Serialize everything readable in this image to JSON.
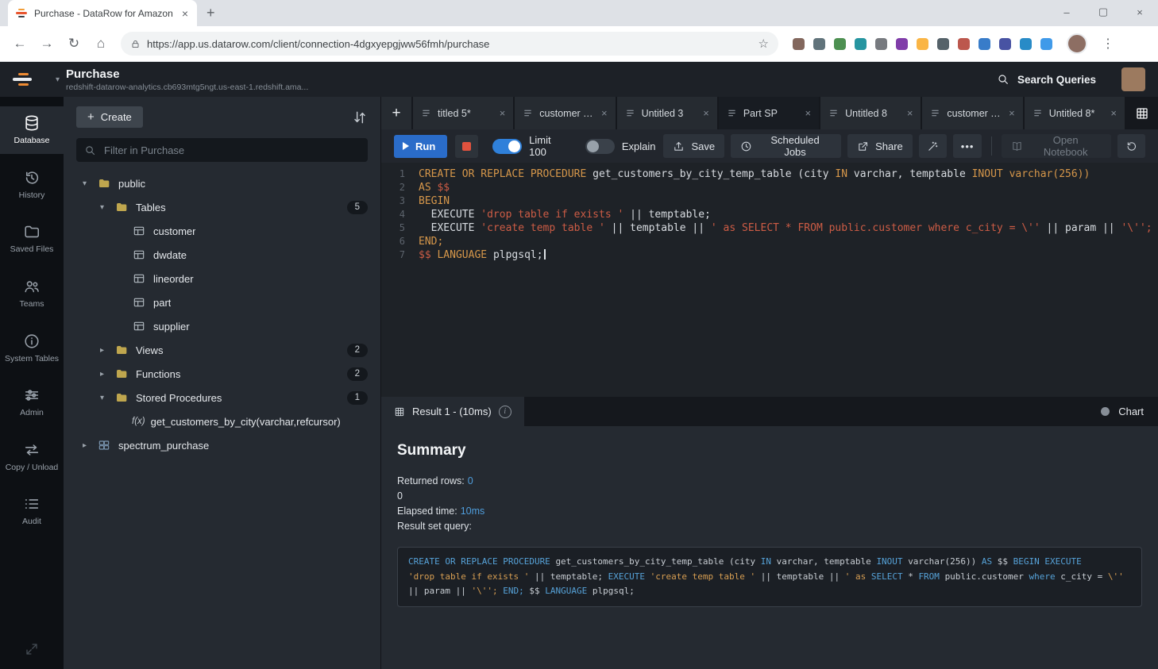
{
  "icons": {
    "plus": "+",
    "close": "×",
    "minimize": "–",
    "maximize": "▢",
    "menu_dots": "⋮",
    "back": "←",
    "forward": "→",
    "reload": "↻",
    "home": "⌂",
    "star": "☆",
    "caret_down": "▾",
    "chevron_down": "▾",
    "chevron_right": "▸",
    "more": "•••"
  },
  "browser": {
    "tab_title": "Purchase - DataRow for Amazon",
    "url": "https://app.us.datarow.com/client/connection-4dgxyepgjww56fmh/purchase",
    "extension_colors": [
      "#6d4c41",
      "#455a64",
      "#2e7d32",
      "#00838f",
      "#5f6368",
      "#6a1b9a",
      "#f9a825",
      "#37474f",
      "#b03a2e",
      "#1565c0",
      "#283593",
      "#0277bd",
      "#1e88e5"
    ]
  },
  "header": {
    "title": "Purchase",
    "subtitle": "redshift-datarow-analytics.cb693mtg5ngt.us-east-1.redshift.ama...",
    "search_label": "Search Queries"
  },
  "sidebar": [
    {
      "label": "Database",
      "icon": "database",
      "active": true
    },
    {
      "label": "History",
      "icon": "history"
    },
    {
      "label": "Saved Files",
      "icon": "folder"
    },
    {
      "label": "Teams",
      "icon": "teams"
    },
    {
      "label": "System Tables",
      "icon": "info"
    },
    {
      "label": "Admin",
      "icon": "sliders"
    },
    {
      "label": "Copy / Unload",
      "icon": "copyunload"
    },
    {
      "label": "Audit",
      "icon": "audit"
    }
  ],
  "explorer": {
    "create_label": "Create",
    "filter_placeholder": "Filter in Purchase",
    "tree": [
      {
        "label": "public",
        "level": 0,
        "chevron": "down",
        "icon": "folder"
      },
      {
        "label": "Tables",
        "level": 1,
        "chevron": "down",
        "icon": "folder",
        "badge": "5"
      },
      {
        "label": "customer",
        "level": 2,
        "icon": "table"
      },
      {
        "label": "dwdate",
        "level": 2,
        "icon": "table"
      },
      {
        "label": "lineorder",
        "level": 2,
        "icon": "table"
      },
      {
        "label": "part",
        "level": 2,
        "icon": "table"
      },
      {
        "label": "supplier",
        "level": 2,
        "icon": "table"
      },
      {
        "label": "Views",
        "level": 1,
        "chevron": "right",
        "icon": "folder",
        "badge": "2"
      },
      {
        "label": "Functions",
        "level": 1,
        "chevron": "right",
        "icon": "folder",
        "badge": "2"
      },
      {
        "label": "Stored Procedures",
        "level": 1,
        "chevron": "down",
        "icon": "folder",
        "badge": "1"
      },
      {
        "label": "get_customers_by_city(varchar,refcursor)",
        "level": 2,
        "icon": "function"
      },
      {
        "label": "spectrum_purchase",
        "level": 0,
        "chevron": "right",
        "icon": "schema"
      }
    ]
  },
  "editor": {
    "tabs": [
      {
        "label": "titled 5*"
      },
      {
        "label": "customer Table"
      },
      {
        "label": "Untitled 3"
      },
      {
        "label": "Part SP",
        "active": true
      },
      {
        "label": "Untitled 8"
      },
      {
        "label": "customer Table*"
      },
      {
        "label": "Untitled 8*"
      }
    ],
    "toolbar": {
      "run": "Run",
      "limit": "Limit 100",
      "explain": "Explain",
      "save": "Save",
      "scheduled_jobs": "Scheduled Jobs",
      "share": "Share",
      "open_notebook": "Open Notebook"
    },
    "code": [
      [
        {
          "t": "CREATE OR REPLACE PROCEDURE ",
          "c": "kw"
        },
        {
          "t": "get_customers_by_city_temp_table (city ",
          "c": "pl"
        },
        {
          "t": "IN ",
          "c": "kw"
        },
        {
          "t": "varchar, temptable ",
          "c": "pl"
        },
        {
          "t": "INOUT ",
          "c": "kw"
        },
        {
          "t": "varchar(256))",
          "c": "kw"
        }
      ],
      [
        {
          "t": "AS ",
          "c": "kw"
        },
        {
          "t": "$$",
          "c": "str"
        }
      ],
      [
        {
          "t": "BEGIN",
          "c": "kw"
        }
      ],
      [
        {
          "t": "  EXECUTE ",
          "c": "pl"
        },
        {
          "t": "'drop table if exists '",
          "c": "str"
        },
        {
          "t": " || temptable;",
          "c": "pl"
        }
      ],
      [
        {
          "t": "  EXECUTE ",
          "c": "pl"
        },
        {
          "t": "'create temp table '",
          "c": "str"
        },
        {
          "t": " || temptable || ",
          "c": "pl"
        },
        {
          "t": "' as SELECT * FROM public.customer where c_city = \\''",
          "c": "str"
        },
        {
          "t": " || param || ",
          "c": "pl"
        },
        {
          "t": "'\\'';",
          "c": "str"
        }
      ],
      [
        {
          "t": "END;",
          "c": "kw"
        }
      ],
      [
        {
          "t": "$$ ",
          "c": "str"
        },
        {
          "t": "LANGUAGE ",
          "c": "kw"
        },
        {
          "t": "plpgsql;",
          "c": "pl"
        }
      ]
    ]
  },
  "results": {
    "tab_label": "Result 1 - (10ms)",
    "chart_label": "Chart",
    "summary_title": "Summary",
    "returned_rows_label": "Returned rows:",
    "returned_rows_value": "0",
    "secondary_value": "0",
    "elapsed_label": "Elapsed time:",
    "elapsed_value": "10ms",
    "query_label": "Result set query:",
    "query": [
      [
        {
          "t": "CREATE OR REPLACE PROCEDURE ",
          "c": "kw"
        },
        {
          "t": "get_customers_by_city_temp_table (city ",
          "c": "pl"
        },
        {
          "t": "IN ",
          "c": "kw"
        },
        {
          "t": "varchar, temptable ",
          "c": "pl"
        },
        {
          "t": "INOUT ",
          "c": "kw"
        },
        {
          "t": "varchar(256)) ",
          "c": "pl"
        },
        {
          "t": "AS ",
          "c": "kw"
        },
        {
          "t": "$$ ",
          "c": "pl"
        },
        {
          "t": "BEGIN EXECUTE",
          "c": "kw"
        }
      ],
      [
        {
          "t": "'drop table if exists ' ",
          "c": "str"
        },
        {
          "t": "|| temptable; ",
          "c": "pl"
        },
        {
          "t": "EXECUTE ",
          "c": "kw"
        },
        {
          "t": "'create temp table ' ",
          "c": "str"
        },
        {
          "t": "|| temptable || ",
          "c": "pl"
        },
        {
          "t": "' as ",
          "c": "str"
        },
        {
          "t": "SELECT ",
          "c": "kw"
        },
        {
          "t": "* ",
          "c": "pl"
        },
        {
          "t": "FROM ",
          "c": "kw"
        },
        {
          "t": "public.customer ",
          "c": "pl"
        },
        {
          "t": "where ",
          "c": "kw"
        },
        {
          "t": "c_city = ",
          "c": "pl"
        },
        {
          "t": "\\''",
          "c": "str"
        }
      ],
      [
        {
          "t": "|| param || ",
          "c": "pl"
        },
        {
          "t": "'\\''; ",
          "c": "str"
        },
        {
          "t": "END; ",
          "c": "kw"
        },
        {
          "t": "$$ ",
          "c": "pl"
        },
        {
          "t": "LANGUAGE ",
          "c": "kw"
        },
        {
          "t": "plpgsql;",
          "c": "pl"
        }
      ]
    ]
  }
}
